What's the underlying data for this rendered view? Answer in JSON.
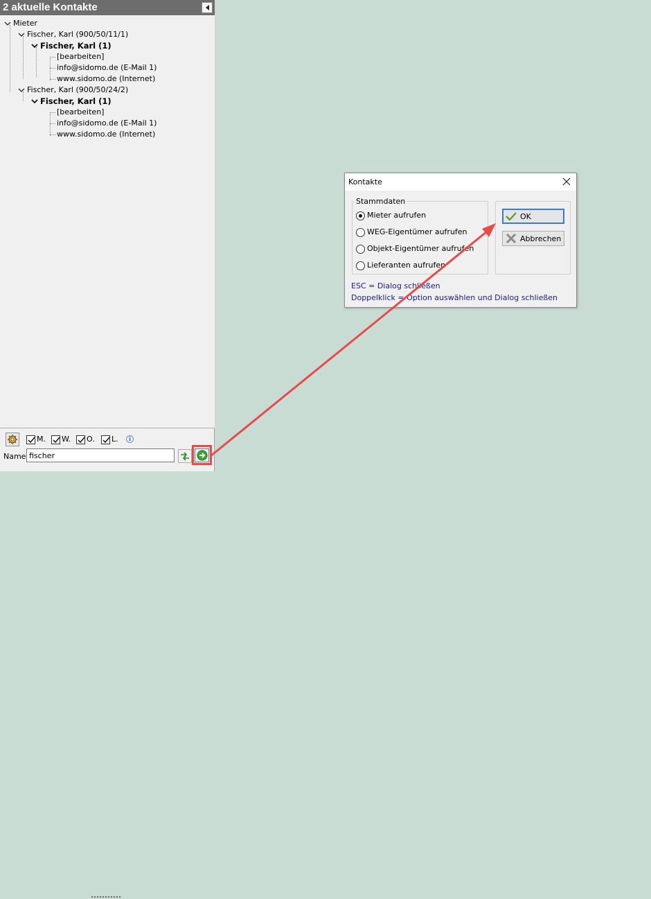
{
  "panel": {
    "title": "2 aktuelle Kontakte"
  },
  "tree": {
    "root_label": "Mieter",
    "contracts": [
      {
        "label": "Fischer, Karl (900/50/11/1)",
        "person": "Fischer, Karl (1)",
        "items": [
          "[bearbeiten]",
          "info@sidomo.de (E-Mail 1)",
          "www.sidomo.de (Internet)"
        ]
      },
      {
        "label": "Fischer, Karl (900/50/24/2)",
        "person": "Fischer, Karl (1)",
        "items": [
          "[bearbeiten]",
          "info@sidomo.de (E-Mail 1)",
          "www.sidomo.de (Internet)"
        ]
      }
    ]
  },
  "filters": {
    "items": [
      {
        "label": "M.",
        "checked": true
      },
      {
        "label": "W.",
        "checked": true
      },
      {
        "label": "O.",
        "checked": true
      },
      {
        "label": "L.",
        "checked": true
      }
    ],
    "info_glyph": "i"
  },
  "search": {
    "label": "Name:",
    "value": "fischer"
  },
  "dialog": {
    "title": "Kontakte",
    "group_label": "Stammdaten",
    "options": [
      {
        "label": "Mieter aufrufen",
        "checked": true
      },
      {
        "label": "WEG-Eigentümer aufrufen",
        "checked": false
      },
      {
        "label": "Objekt-Eigentümer aufrufen",
        "checked": false
      },
      {
        "label": "Lieferanten aufrufen",
        "checked": false
      }
    ],
    "ok_label": "OK",
    "cancel_label": "Abbrechen",
    "hint_esc": "ESC = Dialog schließen",
    "hint_dbl": "Doppelklick = Option auswählen und Dialog schließen"
  },
  "colors": {
    "workspace": "#c8dcd4",
    "header": "#6d6d6d",
    "highlight": "#e84a4a",
    "hint_text": "#1a1a8c"
  }
}
